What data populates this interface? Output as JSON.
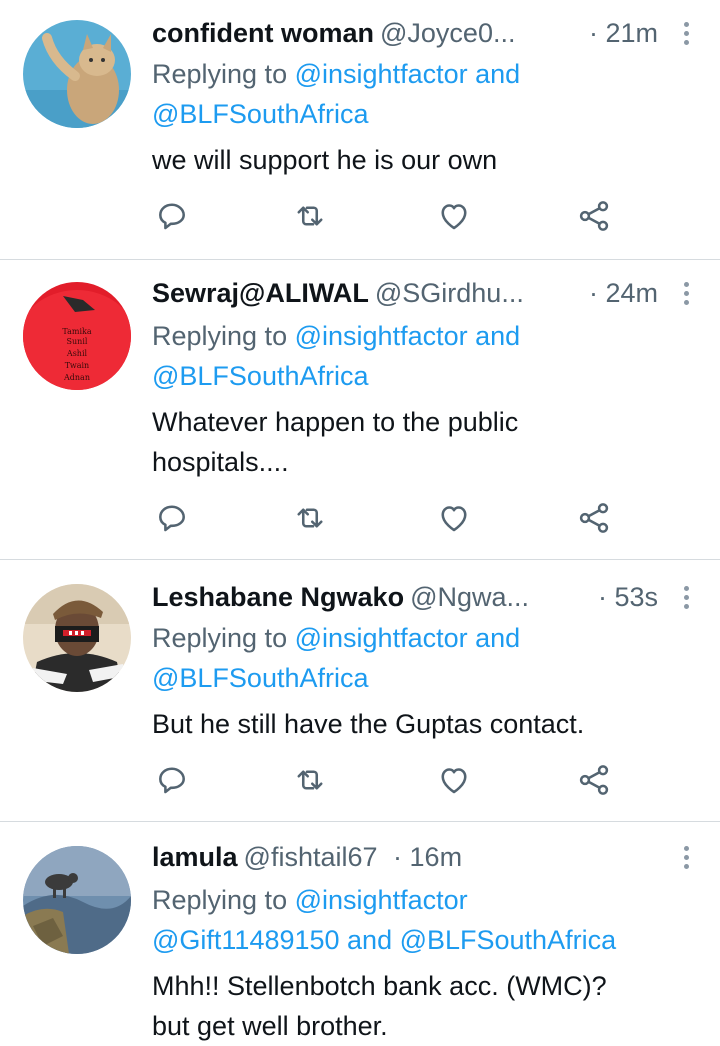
{
  "tweets": [
    {
      "name": "confident woman",
      "handle": "@Joyce0...",
      "time": "· 21m",
      "replying_prefix": "Replying to",
      "reply_line1_handles": "@insightfactor",
      "reply_line1_suffix": " and",
      "reply_line2": "@BLFSouthAfrica",
      "text_lines": [
        "we will support he is our own"
      ]
    },
    {
      "name": "Sewraj@ALIWAL",
      "handle": "@SGirdhu...",
      "time": "· 24m",
      "replying_prefix": "Replying to",
      "reply_line1_handles": "@insightfactor",
      "reply_line1_suffix": " and",
      "reply_line2": "@BLFSouthAfrica",
      "text_lines": [
        "Whatever happen to the public",
        "hospitals...."
      ],
      "avatar_text": [
        "Tamika",
        "Sunil",
        "Ashil",
        "Twain",
        "Adnan"
      ]
    },
    {
      "name": "Leshabane Ngwako",
      "handle": "@Ngwa...",
      "time": "· 53s",
      "replying_prefix": "Replying to",
      "reply_line1_handles": "@insightfactor",
      "reply_line1_suffix": " and",
      "reply_line2": "@BLFSouthAfrica",
      "text_lines": [
        "But he still have the Guptas contact."
      ]
    },
    {
      "name": "lamula",
      "handle": "@fishtail67",
      "time": "· 16m",
      "replying_prefix": "Replying to",
      "reply_line1_handles": "@insightfactor",
      "reply_line1_suffix": "",
      "reply_line2": "@Gift11489150 and @BLFSouthAfrica",
      "text_lines": [
        "Mhh!! Stellenbotch bank acc. (WMC)?",
        "but get well brother."
      ]
    }
  ],
  "icons": {
    "reply": "reply-icon",
    "retweet": "retweet-icon",
    "like": "like-icon",
    "share": "share-icon",
    "more": "more-icon"
  },
  "colors": {
    "link": "#1d9bf0",
    "secondary_text": "#536471",
    "primary_text": "#0f1419",
    "divider": "#d6dbdf"
  }
}
